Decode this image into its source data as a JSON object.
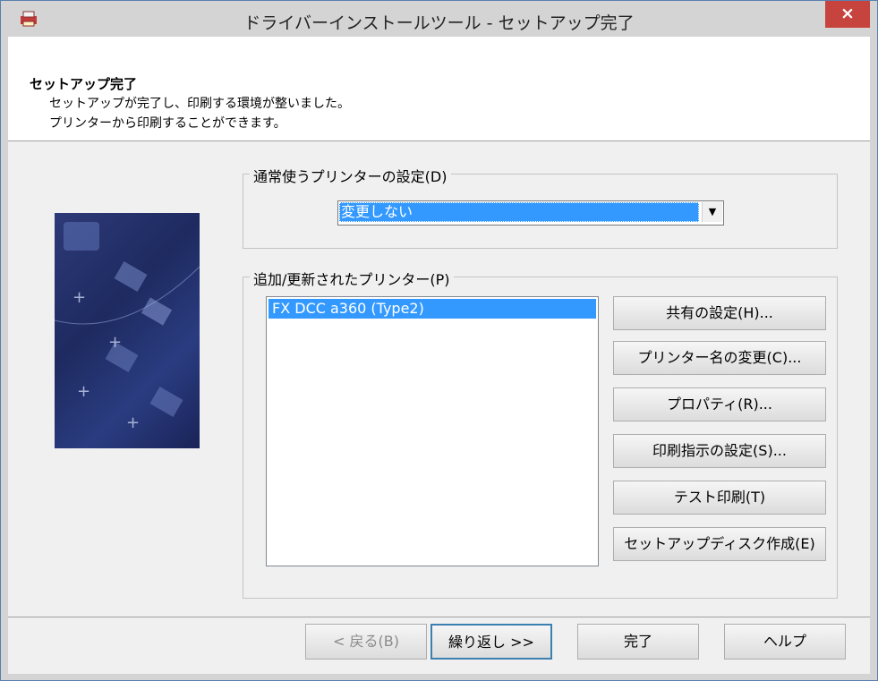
{
  "window": {
    "title": "ドライバーインストールツール - セットアップ完了",
    "close_symbol": "×"
  },
  "header": {
    "title": "セットアップ完了",
    "line1": "セットアップが完了し、印刷する環境が整いました。",
    "line2": "プリンターから印刷することができます。"
  },
  "default_printer_group": {
    "label": "通常使うプリンターの設定(D)",
    "selected_value": "変更しない"
  },
  "printers_group": {
    "label": "追加/更新されたプリンター(P)",
    "items": [
      "FX DCC a360 (Type2)"
    ]
  },
  "side_buttons": {
    "share": "共有の設定(H)...",
    "rename": "プリンター名の変更(C)...",
    "properties": "プロパティ(R)...",
    "print_settings": "印刷指示の設定(S)...",
    "test_print": "テスト印刷(T)",
    "setup_disk": "セットアップディスク作成(E)"
  },
  "footer": {
    "back": "< 戻る(B)",
    "repeat": "繰り返し >>",
    "finish": "完了",
    "help": "ヘルプ"
  },
  "icons": {
    "app": "printer-app-icon",
    "close": "close-icon",
    "dropdown": "chevron-down-icon"
  }
}
